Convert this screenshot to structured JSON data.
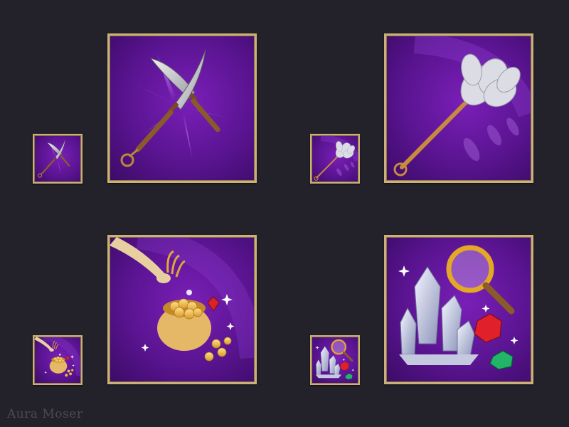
{
  "artist": {
    "signature": "Aura Moser"
  },
  "icons": [
    {
      "name": "crossed-daggers",
      "sizes": [
        "small",
        "large"
      ]
    },
    {
      "name": "feather-duster",
      "sizes": [
        "small",
        "large"
      ]
    },
    {
      "name": "pot-of-gold-coins",
      "sizes": [
        "small",
        "large"
      ]
    },
    {
      "name": "crystals-gems-magnifier",
      "sizes": [
        "small",
        "large"
      ]
    }
  ],
  "colors": {
    "background": "#23222b",
    "frame_gold": "#c9b179",
    "tile_purple": "#5a1491"
  }
}
